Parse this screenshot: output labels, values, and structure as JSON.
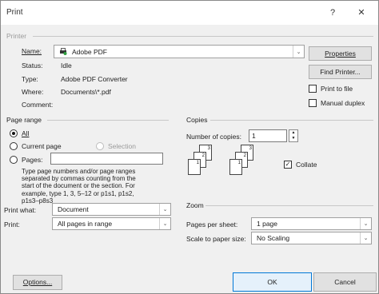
{
  "window": {
    "title": "Print",
    "help_label": "?",
    "close_label": "✕"
  },
  "printer": {
    "section_label": "Printer",
    "name_label": "Name:",
    "name_value": "Adobe PDF",
    "status_label": "Status:",
    "status_value": "Idle",
    "type_label": "Type:",
    "type_value": "Adobe PDF Converter",
    "where_label": "Where:",
    "where_value": "Documents\\*.pdf",
    "comment_label": "Comment:",
    "comment_value": "",
    "properties_button": "Properties",
    "find_printer_button": "Find Printer...",
    "print_to_file_label": "Print to file",
    "print_to_file_checked": false,
    "manual_duplex_label": "Manual duplex",
    "manual_duplex_checked": false
  },
  "page_range": {
    "section_label": "Page range",
    "all_label": "All",
    "current_page_label": "Current page",
    "selection_label": "Selection",
    "pages_label": "Pages:",
    "pages_value": "",
    "selected": "all",
    "help_text_lines": [
      "Type page numbers and/or page ranges",
      "separated by commas counting from the",
      "start of the document or the section. For",
      "example, type 1, 3, 5–12 or p1s1, p1s2,",
      "p1s3–p8s3"
    ]
  },
  "copies": {
    "section_label": "Copies",
    "number_label": "Number of copies:",
    "number_value": "1",
    "collate_label": "Collate",
    "collate_checked": true,
    "stack_a": [
      "3",
      "2",
      "1"
    ],
    "stack_b": [
      "3",
      "2",
      "1"
    ]
  },
  "print_what": {
    "label": "Print what:",
    "value": "Document"
  },
  "print_pages": {
    "label": "Print:",
    "value": "All pages in range"
  },
  "zoom": {
    "section_label": "Zoom",
    "pages_per_sheet_label": "Pages per sheet:",
    "pages_per_sheet_value": "1 page",
    "scale_label": "Scale to paper size:",
    "scale_value": "No Scaling"
  },
  "footer": {
    "options_button": "Options...",
    "ok_button": "OK",
    "cancel_button": "Cancel"
  }
}
